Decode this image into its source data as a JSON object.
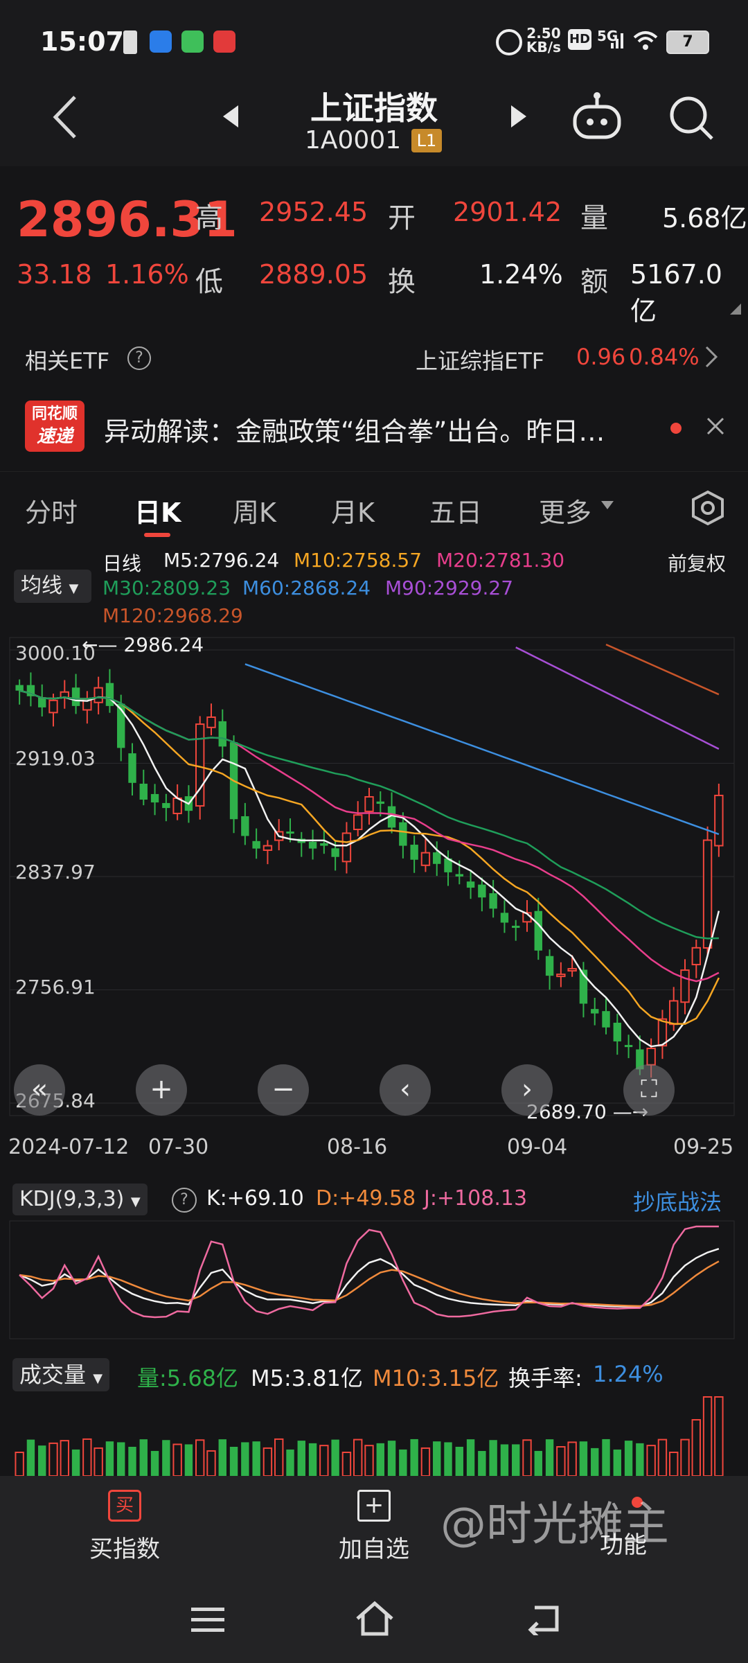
{
  "status": {
    "time": "15:07",
    "net_speed": "2.50",
    "net_unit": "KB/s",
    "hd": "HD",
    "net_type": "5G",
    "battery": "7"
  },
  "header": {
    "title": "上证指数",
    "code": "1A0001",
    "badge": "L1"
  },
  "quote": {
    "price": "2896.31",
    "change": "33.18",
    "change_pct": "1.16%",
    "high_label": "高",
    "high": "2952.45",
    "low_label": "低",
    "low": "2889.05",
    "open_label": "开",
    "open": "2901.42",
    "turnover_label": "换",
    "turnover": "1.24%",
    "volume_label": "量",
    "volume": "5.68亿",
    "amount_label": "额",
    "amount": "5167.0亿"
  },
  "etf": {
    "label": "相关ETF",
    "name": "上证综指ETF",
    "price": "0.96",
    "pct": "0.84%"
  },
  "news": {
    "logo_top": "同花顺",
    "logo_bottom": "速递",
    "text": "异动解读：金融政策“组合拳”出台。昨日…"
  },
  "tabs": [
    {
      "label": "分时"
    },
    {
      "label": "日K"
    },
    {
      "label": "周K"
    },
    {
      "label": "月K"
    },
    {
      "label": "五日"
    },
    {
      "label": "更多"
    }
  ],
  "chart": {
    "mode": "均线",
    "period": "日线",
    "adjust": "前复权",
    "ma": [
      {
        "label": "M5:2796.24",
        "color": "#f2f2f2"
      },
      {
        "label": "M10:2758.57",
        "color": "#f5a623"
      },
      {
        "label": "M20:2781.30",
        "color": "#e83e8c"
      },
      {
        "label": "M30:2809.23",
        "color": "#1f9e5a"
      },
      {
        "label": "M60:2868.24",
        "color": "#3d8fe0"
      },
      {
        "label": "M90:2929.27",
        "color": "#a84fd6"
      },
      {
        "label": "M120:2968.29",
        "color": "#c8552a"
      }
    ],
    "y_labels": [
      "3000.10",
      "2919.03",
      "2837.97",
      "2756.91",
      "2675.84"
    ],
    "high_mark": "2986.24",
    "low_mark": "2689.70",
    "x_labels": [
      "2024-07-12",
      "07-30",
      "08-16",
      "09-04",
      "09-25"
    ]
  },
  "kdj": {
    "label": "KDJ(9,3,3)",
    "k": "K:+69.10",
    "d": "D:+49.58",
    "j": "J:+108.13",
    "link": "抄底战法"
  },
  "volume": {
    "label": "成交量",
    "vol": "量:5.68亿",
    "m5": "M5:3.81亿",
    "m10": "M10:3.15亿",
    "turn_label": "换手率:",
    "turn": "1.24%"
  },
  "bottom": {
    "buy": "买指数",
    "buy_icon": "买",
    "add": "加自选",
    "func": "功能",
    "watermark": "@时光摊主"
  },
  "chart_data": {
    "type": "candlestick",
    "x": [
      "2024-07-12",
      "07-30",
      "08-16",
      "09-04",
      "09-25"
    ],
    "ylim": [
      2675.84,
      3000.1
    ],
    "y_ticks": [
      3000.1,
      2919.03,
      2837.97,
      2756.91,
      2675.84
    ],
    "period_high": 2986.24,
    "period_low": 2689.7,
    "ma_latest": {
      "M5": 2796.24,
      "M10": 2758.57,
      "M20": 2781.3,
      "M30": 2809.23,
      "M60": 2868.24,
      "M90": 2929.27,
      "M120": 2968.29
    },
    "candles_close_approx": [
      2971,
      2967,
      2959,
      2964,
      2970,
      2960,
      2965,
      2973,
      2960,
      2930,
      2905,
      2893,
      2891,
      2887,
      2894,
      2885,
      2947,
      2952,
      2931,
      2879,
      2867,
      2858,
      2860,
      2870,
      2869,
      2862,
      2858,
      2860,
      2852,
      2869,
      2882,
      2895,
      2890,
      2873,
      2860,
      2850,
      2855,
      2847,
      2841,
      2838,
      2830,
      2823,
      2815,
      2805,
      2802,
      2812,
      2785,
      2767,
      2768,
      2772,
      2747,
      2740,
      2730,
      2720,
      2717,
      2700,
      2715,
      2736,
      2749,
      2771,
      2787,
      2864,
      2896
    ],
    "kdj": {
      "K": 69.1,
      "D": 49.58,
      "J": 108.13
    },
    "volume": {
      "latest": "5.68亿",
      "M5": "3.81亿",
      "M10": "3.15亿",
      "turnover": "1.24%"
    }
  }
}
